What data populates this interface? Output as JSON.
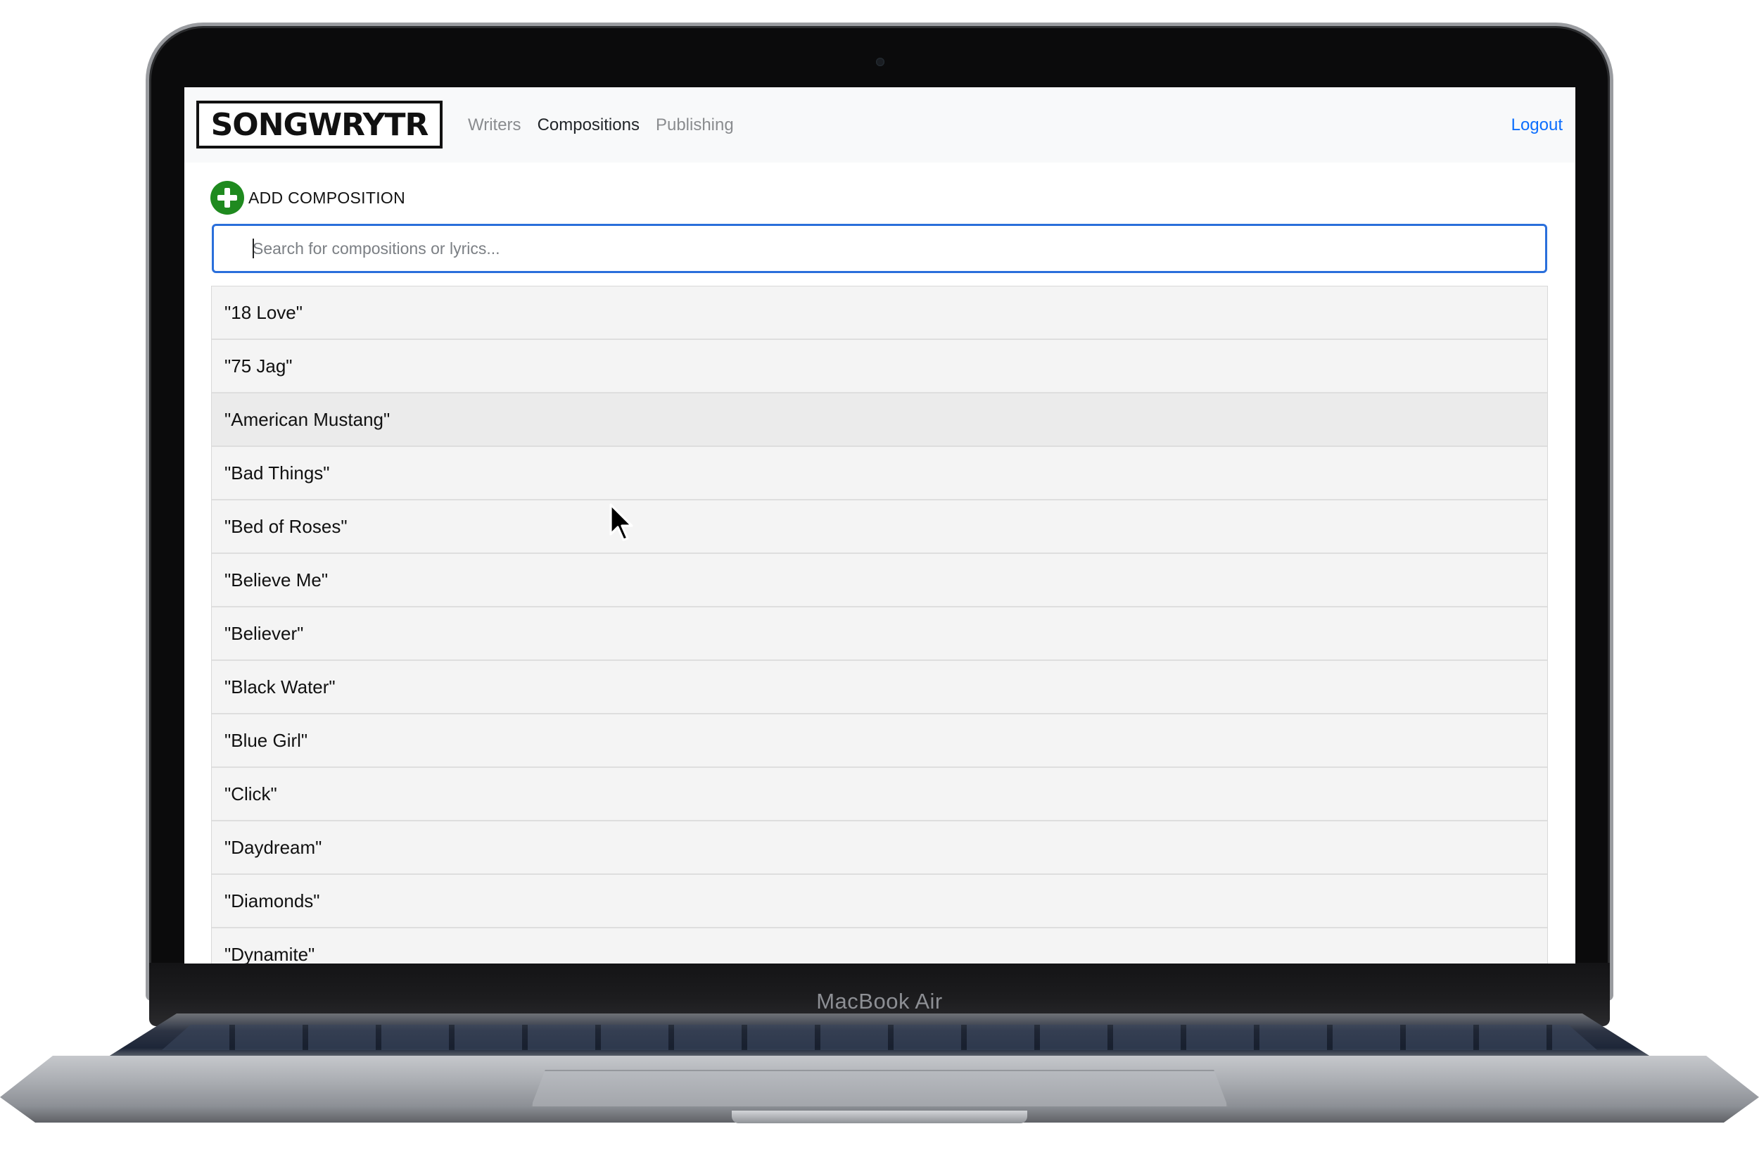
{
  "device": {
    "label": "MacBook Air"
  },
  "navbar": {
    "brand": "SONGWRYTR",
    "links": [
      {
        "label": "Writers",
        "active": false
      },
      {
        "label": "Compositions",
        "active": true
      },
      {
        "label": "Publishing",
        "active": false
      }
    ],
    "logout_label": "Logout"
  },
  "toolbar": {
    "add_label": "ADD COMPOSITION",
    "add_icon": "plus-circle-icon"
  },
  "search": {
    "placeholder": "Search for compositions or lyrics...",
    "value": ""
  },
  "compositions": [
    "\"18 Love\"",
    "\"75 Jag\"",
    "\"American Mustang\"",
    "\"Bad Things\"",
    "\"Bed of Roses\"",
    "\"Believe Me\"",
    "\"Believer\"",
    "\"Black Water\"",
    "\"Blue Girl\"",
    "\"Click\"",
    "\"Daydream\"",
    "\"Diamonds\"",
    "\"Dynamite\""
  ],
  "hovered_index": 2,
  "colors": {
    "accent": "#0d6efd",
    "add_icon": "#1f8a1f",
    "search_border": "#2a6fdb"
  }
}
